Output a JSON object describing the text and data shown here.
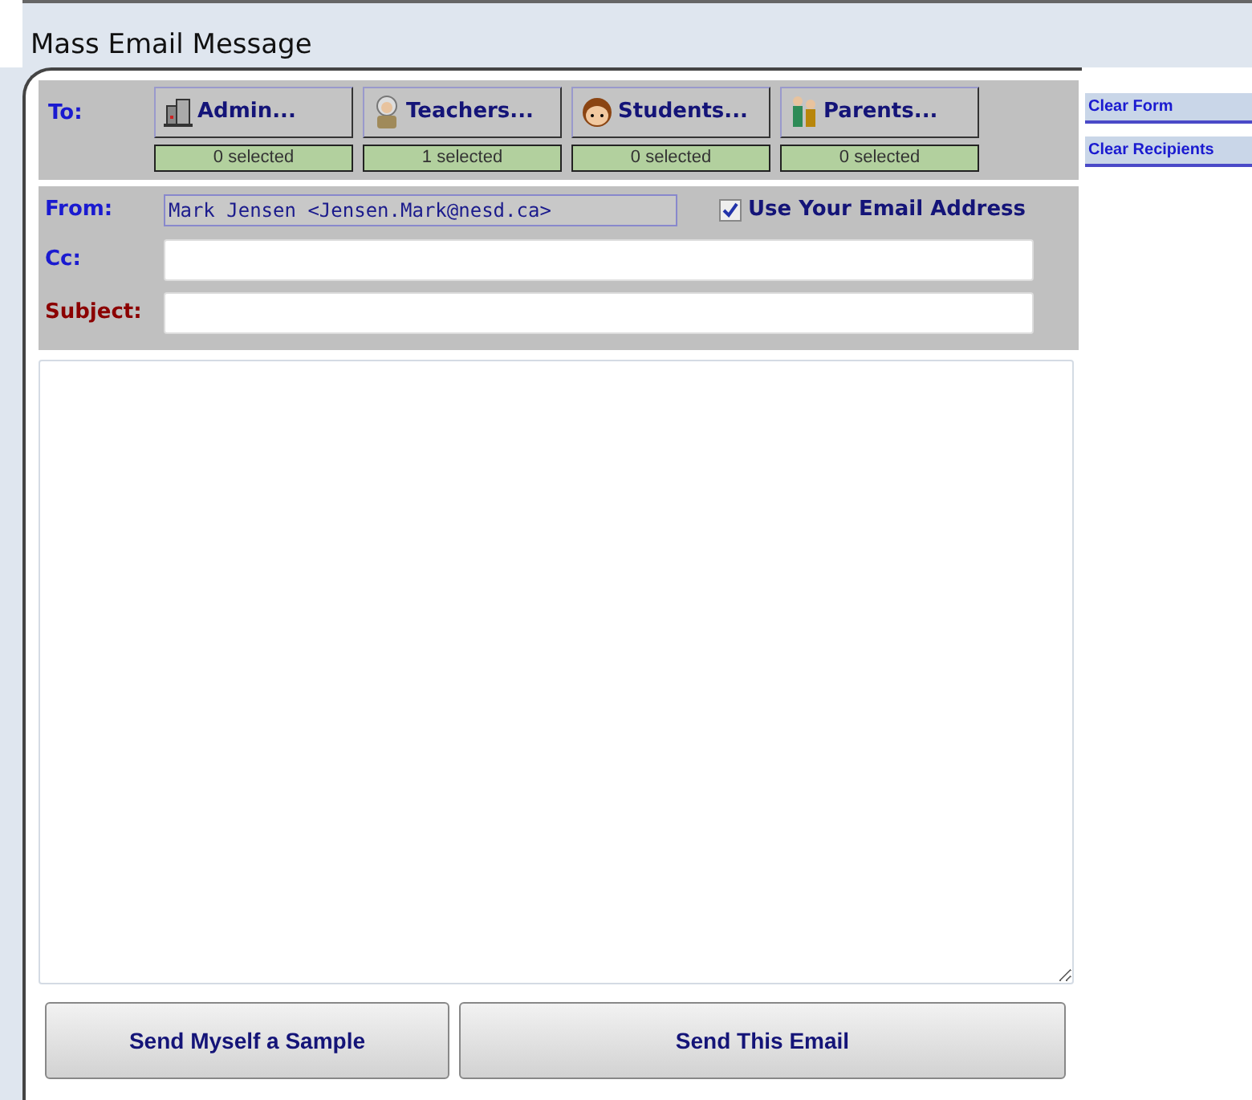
{
  "window": {
    "title": "Mass Email Message"
  },
  "to_label": "To:",
  "recipient_groups": [
    {
      "kind": "admin",
      "label": "Admin...",
      "count": "0 selected"
    },
    {
      "kind": "teachers",
      "label": "Teachers...",
      "count": "1 selected"
    },
    {
      "kind": "students",
      "label": "Students...",
      "count": "0 selected"
    },
    {
      "kind": "parents",
      "label": "Parents...",
      "count": "0 selected"
    }
  ],
  "from": {
    "label": "From:",
    "value": "Mark Jensen <Jensen.Mark@nesd.ca>"
  },
  "use_own_address": {
    "label": "Use Your Email Address",
    "checked": true
  },
  "cc": {
    "label": "Cc:"
  },
  "subject": {
    "label": "Subject:"
  },
  "side_links": [
    "Clear Form",
    "Clear Recipients"
  ],
  "buttons": [
    "Send Myself a Sample",
    "Send This Email"
  ]
}
